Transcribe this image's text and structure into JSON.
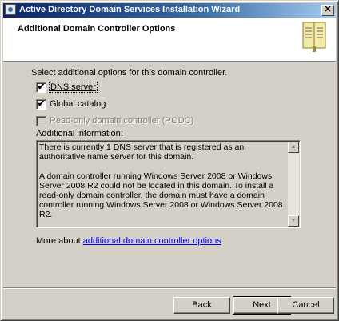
{
  "window": {
    "title": "Active Directory Domain Services Installation Wizard",
    "close_glyph": "✕"
  },
  "header": {
    "title": "Additional Domain Controller Options",
    "icon": "book-icon"
  },
  "main": {
    "intro": "Select additional options for this domain controller.",
    "options": [
      {
        "label": "DNS server",
        "checked": true,
        "enabled": true
      },
      {
        "label": "Global catalog",
        "checked": true,
        "enabled": true
      },
      {
        "label": "Read-only domain controller (RODC)",
        "checked": false,
        "enabled": false
      }
    ],
    "info_label": "Additional information:",
    "info_text": "There is currently 1 DNS server that is registered as an authoritative name server for this domain.\n\nA domain controller running Windows Server 2008 or Windows Server 2008 R2 could not be located in this domain. To install a read-only domain controller, the domain must have a domain controller running Windows Server 2008 or Windows Server 2008 R2.",
    "more_prefix": "More about ",
    "more_link": "additional domain controller options"
  },
  "buttons": {
    "back": "Back",
    "next": "Next",
    "cancel": "Cancel"
  },
  "glyphs": {
    "check": "✔",
    "scroll_up": "▲",
    "scroll_down": "▼"
  }
}
